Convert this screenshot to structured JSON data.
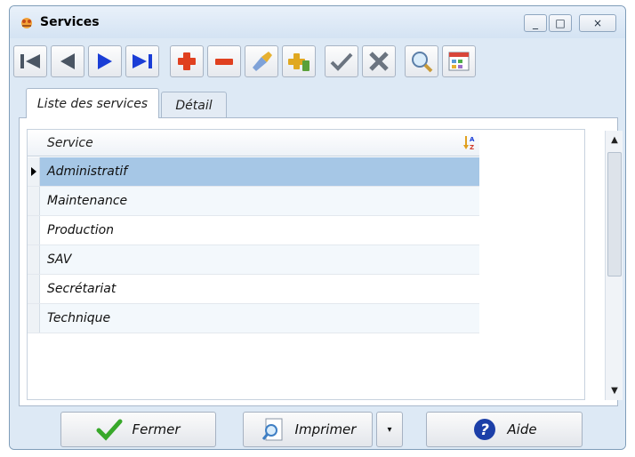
{
  "window": {
    "title": "Services"
  },
  "window_controls": {
    "minimize": "_",
    "maximize": "□",
    "close": "×"
  },
  "toolbar": {
    "buttons": [
      {
        "name": "first-record",
        "icon": "skip-first-icon"
      },
      {
        "name": "previous-record",
        "icon": "previous-icon"
      },
      {
        "name": "next-record",
        "icon": "next-icon"
      },
      {
        "name": "last-record",
        "icon": "skip-last-icon"
      },
      {
        "name": "add-record",
        "icon": "plus-icon"
      },
      {
        "name": "delete-record",
        "icon": "minus-icon"
      },
      {
        "name": "edit-record",
        "icon": "brush-icon"
      },
      {
        "name": "duplicate-record",
        "icon": "copy-plus-icon"
      },
      {
        "name": "validate",
        "icon": "check-icon"
      },
      {
        "name": "cancel",
        "icon": "cross-icon"
      },
      {
        "name": "search",
        "icon": "magnifier-icon"
      },
      {
        "name": "table-options",
        "icon": "table-icon"
      }
    ]
  },
  "tabs": [
    {
      "label": "Liste des services",
      "active": true
    },
    {
      "label": "Détail",
      "active": false
    }
  ],
  "grid": {
    "column_header": "Service",
    "rows": [
      "Administratif",
      "Maintenance",
      "Production",
      "SAV",
      "Secrétariat",
      "Technique"
    ],
    "selected_index": 0
  },
  "footer": {
    "close_label": "Fermer",
    "print_label": "Imprimer",
    "help_label": "Aide"
  },
  "colors": {
    "selection": "#a6c7e6",
    "accent_red": "#e0401f",
    "accent_blue": "#1a3dd6",
    "check_green": "#38a82a"
  }
}
